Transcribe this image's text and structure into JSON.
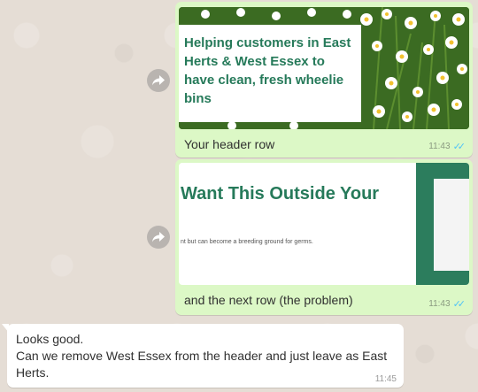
{
  "messages": [
    {
      "direction": "outgoing",
      "image": {
        "header_text": "Helping customers in East Herts & West Essex to have clean, fresh wheelie bins"
      },
      "caption": "Your header row",
      "time": "11:43",
      "status_icon": "double-tick-read-icon"
    },
    {
      "direction": "outgoing",
      "image": {
        "heading_text": "Want This Outside Your",
        "subtext": "nt but can become a breeding ground for germs."
      },
      "caption": "and the next row (the problem)",
      "time": "11:43",
      "status_icon": "double-tick-read-icon"
    },
    {
      "direction": "incoming",
      "lines": [
        "Looks good.",
        "Can we remove West Essex from the header and just leave as East Herts."
      ],
      "time": "11:45"
    }
  ],
  "colors": {
    "chat_background": "#e5ddd5",
    "outgoing_bubble": "#dcf8c6",
    "incoming_bubble": "#ffffff",
    "brand_green": "#267a5a",
    "read_tick": "#4fc3f7"
  }
}
